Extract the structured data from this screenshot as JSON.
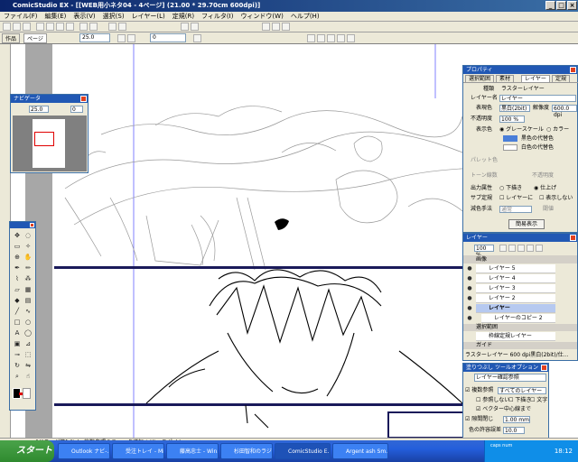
{
  "window": {
    "title": "ComicStudio EX - [[WEB用小ネタ04 - 4ページ] (21.00 * 29.70cm 600dpi)]",
    "controls": [
      "_",
      "□",
      "×"
    ]
  },
  "menu": [
    "ファイル(F)",
    "編集(E)",
    "表示(V)",
    "選択(S)",
    "レイヤー(L)",
    "定規(R)",
    "フィルタ(I)",
    "ウィンドウ(W)",
    "ヘルプ(H)"
  ],
  "toolbar": {
    "zoom": "25.0",
    "rotation": "0"
  },
  "tabs": {
    "work": "作品",
    "page": "ページ"
  },
  "navigator": {
    "title": "ナビゲータ",
    "zoom": "25.0",
    "rotation": "0"
  },
  "property": {
    "title": "プロパティ",
    "tabs": [
      "選択範囲",
      "素材",
      "レイヤー",
      "定規"
    ],
    "kind_label": "種類",
    "kind_value": "ラスターレイヤー",
    "name_label": "レイヤー名",
    "name_value": "レイヤー",
    "expr_label": "表現色",
    "expr_value": "黒白(2bit)",
    "res_label": "解像度",
    "res_value": "600.0 dpi",
    "opacity_label": "不透明度",
    "opacity_value": "100 %",
    "display_label": "表示色",
    "gray_option": "グレースケール",
    "color_option": "カラー",
    "black_sub": "黒色の代替色",
    "white_sub": "白色の代替色",
    "palette_label": "パレット色",
    "tone_label": "トーン線数",
    "tone_opacity_label": "不透明度",
    "output_label": "出力属性",
    "output_draft": "下描き",
    "output_final": "仕上げ",
    "sub_label": "サブ定規",
    "sub_layer": "レイヤーに",
    "sub_show": "表示しない",
    "subtract_label": "減色手法",
    "subtract_value": "通常",
    "threshold_label": "閾値",
    "simple_button": "簡易表示"
  },
  "layer_panel": {
    "title": "レイヤー",
    "opacity": "100 %",
    "folder": "画像",
    "layers": [
      "レイヤー 5",
      "レイヤー 4",
      "レイヤー 3",
      "レイヤー 2",
      "レイヤー",
      "レイヤーのコピー 2"
    ],
    "selection_folder": "選択範囲",
    "border_layer": "枠線定規レイヤー",
    "guide_folder": "ガイド",
    "status": "ラスターレイヤー 600 dpi黒白(2bit)/仕..."
  },
  "fill_panel": {
    "title": "塗りつぶし ツールオプション",
    "preset": "レイヤー確認参照",
    "ref_label": "複数参照",
    "ref_value": "すべてのレイヤー",
    "ref_none": "参照しない",
    "draft": "下描き",
    "text": "文字",
    "vector_center": "ベクター中心線まで",
    "gap_label": "隙間閉じ",
    "gap_value": "1.00 mm",
    "tolerance_label": "色の許容誤差",
    "tolerance_value": "10.0"
  },
  "statusbar": {
    "text": "[ドラッグ範] Ctrl : 複数参照のチェック逆転 / Alt : スポイト"
  },
  "taskbar": {
    "start": "スタート",
    "tasks": [
      "Outlook ナビ-...",
      "受注トレイ - Mi...",
      "藤高忠士 - Win...",
      "杉田智和のラジオ...",
      "ComicStudio E...",
      "Argent ash Sm..."
    ],
    "tray_text": "caps num",
    "clock": "18:12"
  },
  "colors": {
    "titlebar": "#0a246a",
    "accent": "#2158b4",
    "taskbar": "#245edb"
  }
}
